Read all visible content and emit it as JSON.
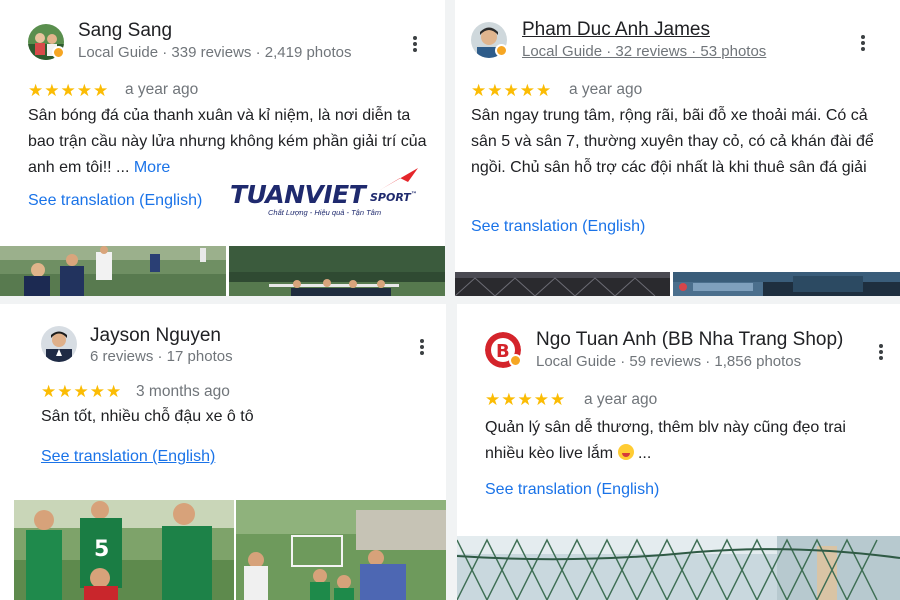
{
  "reviews": [
    {
      "name": "Sang Sang",
      "meta": "Local Guide · 339 reviews · 2,419 photos",
      "ago": "a year ago",
      "text": "Sân bóng đá của thanh xuân và kỉ niệm, là nơi diễn ta bao trận cầu này lửa nhưng không kém phần giải trí của anh em tôi!! ...",
      "more": "More",
      "translate": "See translation (English)",
      "logo": {
        "main": "TUANVIET",
        "sport": "SPORT",
        "tm": "™",
        "slogan": "Chất Lượng - Hiệu quả - Tận Tâm"
      }
    },
    {
      "name": "Pham Duc Anh James",
      "meta": "Local Guide · 32 reviews · 53 photos",
      "ago": "a year ago",
      "text": "Sân ngay trung tâm, rộng rãi, bãi đỗ xe thoải mái. Có cả sân 5 và sân 7, thường xuyên thay cỏ, có cả khán đài để ngồi. Chủ sân hỗ trợ các đội nhất là khi thuê sân đá giải",
      "translate": "See translation (English)"
    },
    {
      "name": "Jayson Nguyen",
      "meta": "6 reviews · 17 photos",
      "ago": "3 months ago",
      "text": "Sân tốt, nhiều chỗ đậu xe ô tô",
      "translate": "See translation (English)"
    },
    {
      "name": "Ngo Tuan Anh (BB Nha Trang Shop)",
      "meta": "Local Guide · 59 reviews · 1,856 photos",
      "ago": "a year ago",
      "text": "Quản lý sân dễ thương, thêm blv này cũng đẹo trai nhiều kèo live lắm",
      "text_tail": "...",
      "translate": "See translation (English)",
      "shirt_number": "5"
    }
  ],
  "rating": {
    "stars": 5,
    "star_glyph": "★"
  },
  "colors": {
    "star": "#fbbc04",
    "link": "#1a73e8",
    "meta": "#70757a",
    "text": "#202124",
    "badge": "#f6a623"
  },
  "icons": [
    "more-vert-icon",
    "local-guide-badge-icon",
    "star-icon",
    "laughing-emoji-icon"
  ]
}
